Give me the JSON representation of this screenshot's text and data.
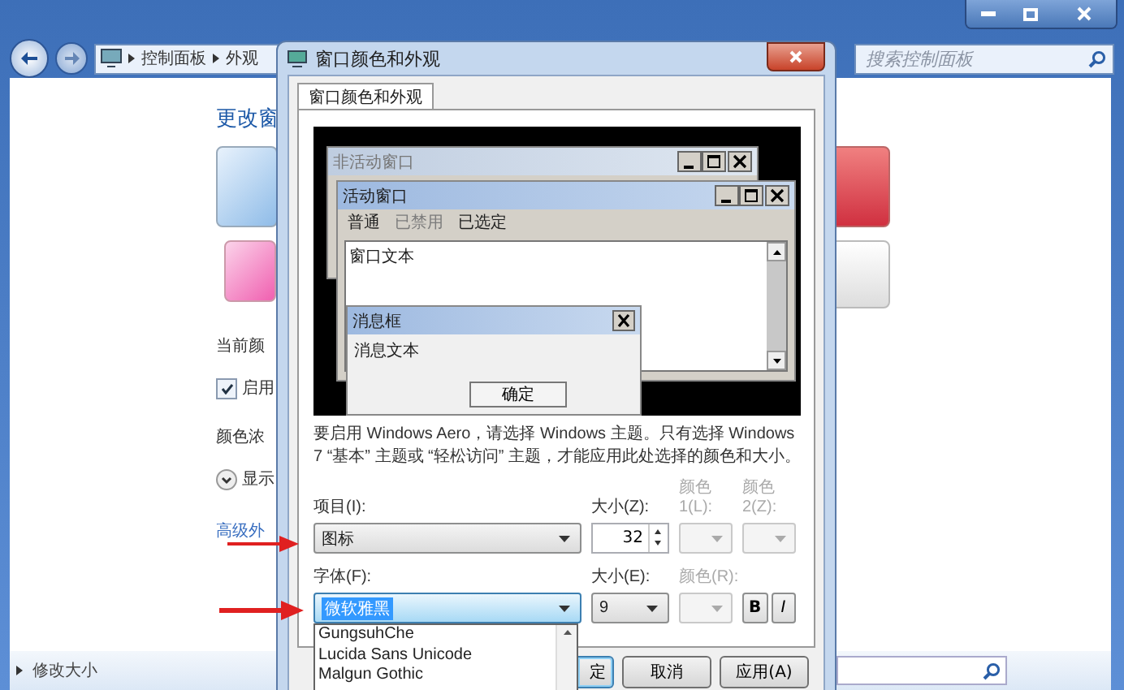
{
  "explorer": {
    "breadcrumb": [
      "控制面板",
      "外观"
    ],
    "search": {
      "placeholder": "搜索控制面板"
    },
    "heading": "更改窗",
    "current_color": "当前颜",
    "transparency": {
      "label": "启用",
      "checked": true
    },
    "intensity": "颜色浓",
    "expander": "显示",
    "advanced_link": "高级外",
    "status": "修改大小"
  },
  "dialog": {
    "title": "窗口颜色和外观",
    "tabs": [
      {
        "label": "窗口颜色和外观",
        "selected": true
      }
    ],
    "preview": {
      "inactive_title": "非活动窗口",
      "active_title": "活动窗口",
      "menu": [
        {
          "label": "普通",
          "disabled": false
        },
        {
          "label": "已禁用",
          "disabled": true
        },
        {
          "label": "已选定",
          "disabled": false
        }
      ],
      "window_text": "窗口文本",
      "message_title": "消息框",
      "message_text": "消息文本",
      "ok": "确定"
    },
    "note": "要启用 Windows Aero，请选择 Windows 主题。只有选择 Windows 7 “基本” 主题或 “轻松访问” 主题，才能应用此处选择的颜色和大小。",
    "item": {
      "label": "项目(I):",
      "value": "图标"
    },
    "item_size": {
      "label": "大小(Z):",
      "value": "32"
    },
    "color1": {
      "label": "颜色 1(L):",
      "disabled": true
    },
    "color2": {
      "label": "颜色 2(Z):",
      "disabled": true
    },
    "font": {
      "label": "字体(F):",
      "value": "微软雅黑",
      "focused": true
    },
    "font_size": {
      "label": "大小(E):",
      "value": "9"
    },
    "font_color": {
      "label": "颜色(R):",
      "disabled": true
    },
    "bold": "B",
    "italic": "I",
    "font_list": [
      "GungsuhChe",
      "Lucida Sans Unicode",
      "Malgun Gothic"
    ],
    "buttons": [
      {
        "label": "定",
        "default": true
      },
      {
        "label": "取消",
        "default": false
      },
      {
        "label": "应用(A)",
        "default": false
      }
    ]
  }
}
